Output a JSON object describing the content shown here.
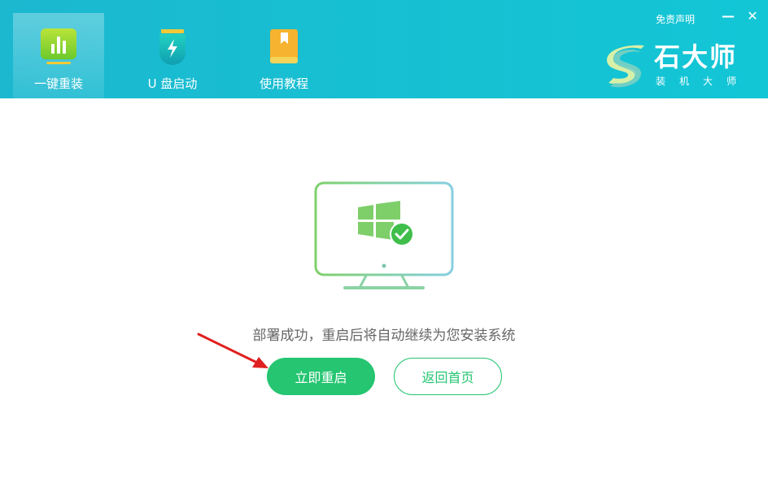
{
  "tabs": [
    {
      "label": "一键重装",
      "icon": "bar-chart-icon",
      "active": true
    },
    {
      "label": "U 盘启动",
      "icon": "usb-drive-icon",
      "active": false
    },
    {
      "label": "使用教程",
      "icon": "book-icon",
      "active": false
    }
  ],
  "header": {
    "disclaimer_label": "免责声明",
    "minimize_symbol": "—",
    "close_symbol": "✕"
  },
  "brand": {
    "name": "石大师",
    "subtitle": "装机大师"
  },
  "main": {
    "message": "部署成功，重启后将自动继续为您安装系统",
    "restart_button": "立即重启",
    "home_button": "返回首页"
  },
  "colors": {
    "header": "#17bfd3",
    "accent_green": "#25c571",
    "arrow_red": "#e02020"
  }
}
